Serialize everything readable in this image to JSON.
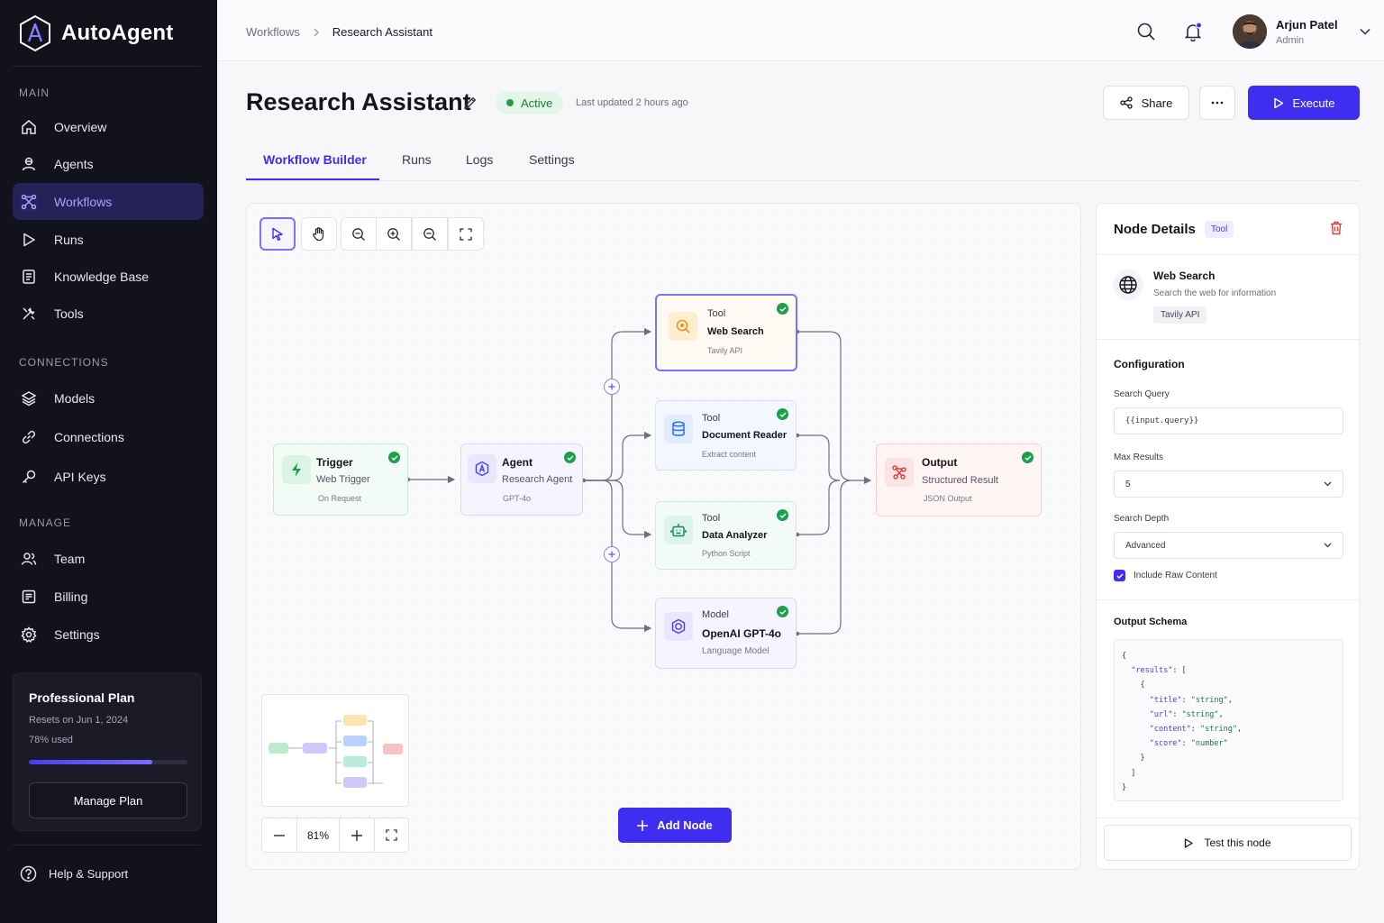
{
  "app": {
    "name": "AutoAgent",
    "accent": "#3f2df0"
  },
  "sidebar": {
    "sections": {
      "main": "MAIN",
      "connections": "CONNECTIONS",
      "manage": "MANAGE"
    },
    "items": [
      {
        "label": "Overview",
        "icon": "home-icon"
      },
      {
        "label": "Agents",
        "icon": "agent-icon"
      },
      {
        "label": "Workflows",
        "icon": "workflow-icon",
        "active": true
      },
      {
        "label": "Runs",
        "icon": "play-icon"
      },
      {
        "label": "Knowledge Base",
        "icon": "book-icon"
      },
      {
        "label": "Tools",
        "icon": "tools-icon"
      },
      {
        "label": "Models",
        "icon": "layers-icon"
      },
      {
        "label": "Connections",
        "icon": "link-icon"
      },
      {
        "label": "API Keys",
        "icon": "key-icon"
      },
      {
        "label": "Team",
        "icon": "team-icon"
      },
      {
        "label": "Billing",
        "icon": "billing-icon"
      },
      {
        "label": "Settings",
        "icon": "gear-icon"
      }
    ],
    "plan": {
      "title": "Professional Plan",
      "resets": "Resets on Jun 1, 2024",
      "used": "78% used",
      "used_fraction": 0.78,
      "button": "Manage Plan"
    },
    "help": "Help & Support"
  },
  "header": {
    "breadcrumb": [
      "Workflows",
      "Research Assistant"
    ],
    "user": {
      "name": "Arjun Patel",
      "role": "Admin"
    }
  },
  "page": {
    "title": "Research Assistant",
    "status": "Active",
    "updated": "Last updated 2 hours ago",
    "share": "Share",
    "execute": "Execute",
    "tabs": [
      "Workflow Builder",
      "Runs",
      "Logs",
      "Settings"
    ]
  },
  "canvas": {
    "nodes": {
      "trigger": {
        "label": "Trigger",
        "title": "Web Trigger",
        "sub": "On Request"
      },
      "agent": {
        "label": "Agent",
        "title": "Research Agent",
        "sub": "GPT-4o"
      },
      "web_search": {
        "label": "Tool",
        "title": "Web Search",
        "sub": "Tavily API"
      },
      "doc_reader": {
        "label": "Tool",
        "title": "Document Reader",
        "sub": "Extract content"
      },
      "data_analyzer": {
        "label": "Tool",
        "title": "Data Analyzer",
        "sub": "Python Script"
      },
      "model": {
        "label": "Model",
        "title": "OpenAI GPT-4o",
        "sub": "Language Model"
      },
      "output": {
        "label": "Output",
        "title": "Structured Result",
        "sub": "JSON Output"
      }
    },
    "zoom": "81%",
    "add_node": "Add Node"
  },
  "panel": {
    "title": "Node Details",
    "tag": "Tool",
    "node_name": "Web Search",
    "node_desc": "Search the web for information",
    "node_tag": "Tavily API",
    "config_title": "Configuration",
    "search_query_label": "Search Query",
    "search_query_value": "{{input.query}}",
    "max_results_label": "Max Results",
    "max_results_value": "5",
    "depth_label": "Search Depth",
    "depth_value": "Advanced",
    "raw_label": "Include Raw Content",
    "schema_title": "Output Schema",
    "test_button": "Test this node"
  }
}
